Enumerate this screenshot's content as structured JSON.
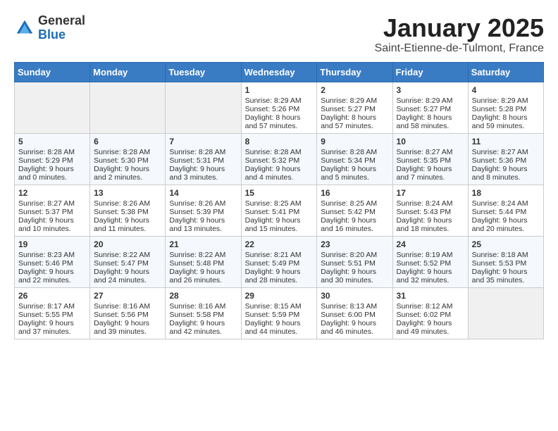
{
  "header": {
    "logo_general": "General",
    "logo_blue": "Blue",
    "month": "January 2025",
    "location": "Saint-Etienne-de-Tulmont, France"
  },
  "days_of_week": [
    "Sunday",
    "Monday",
    "Tuesday",
    "Wednesday",
    "Thursday",
    "Friday",
    "Saturday"
  ],
  "weeks": [
    [
      {
        "day": "",
        "info": ""
      },
      {
        "day": "",
        "info": ""
      },
      {
        "day": "",
        "info": ""
      },
      {
        "day": "1",
        "info": "Sunrise: 8:29 AM\nSunset: 5:26 PM\nDaylight: 8 hours and 57 minutes."
      },
      {
        "day": "2",
        "info": "Sunrise: 8:29 AM\nSunset: 5:27 PM\nDaylight: 8 hours and 57 minutes."
      },
      {
        "day": "3",
        "info": "Sunrise: 8:29 AM\nSunset: 5:27 PM\nDaylight: 8 hours and 58 minutes."
      },
      {
        "day": "4",
        "info": "Sunrise: 8:29 AM\nSunset: 5:28 PM\nDaylight: 8 hours and 59 minutes."
      }
    ],
    [
      {
        "day": "5",
        "info": "Sunrise: 8:28 AM\nSunset: 5:29 PM\nDaylight: 9 hours and 0 minutes."
      },
      {
        "day": "6",
        "info": "Sunrise: 8:28 AM\nSunset: 5:30 PM\nDaylight: 9 hours and 2 minutes."
      },
      {
        "day": "7",
        "info": "Sunrise: 8:28 AM\nSunset: 5:31 PM\nDaylight: 9 hours and 3 minutes."
      },
      {
        "day": "8",
        "info": "Sunrise: 8:28 AM\nSunset: 5:32 PM\nDaylight: 9 hours and 4 minutes."
      },
      {
        "day": "9",
        "info": "Sunrise: 8:28 AM\nSunset: 5:34 PM\nDaylight: 9 hours and 5 minutes."
      },
      {
        "day": "10",
        "info": "Sunrise: 8:27 AM\nSunset: 5:35 PM\nDaylight: 9 hours and 7 minutes."
      },
      {
        "day": "11",
        "info": "Sunrise: 8:27 AM\nSunset: 5:36 PM\nDaylight: 9 hours and 8 minutes."
      }
    ],
    [
      {
        "day": "12",
        "info": "Sunrise: 8:27 AM\nSunset: 5:37 PM\nDaylight: 9 hours and 10 minutes."
      },
      {
        "day": "13",
        "info": "Sunrise: 8:26 AM\nSunset: 5:38 PM\nDaylight: 9 hours and 11 minutes."
      },
      {
        "day": "14",
        "info": "Sunrise: 8:26 AM\nSunset: 5:39 PM\nDaylight: 9 hours and 13 minutes."
      },
      {
        "day": "15",
        "info": "Sunrise: 8:25 AM\nSunset: 5:41 PM\nDaylight: 9 hours and 15 minutes."
      },
      {
        "day": "16",
        "info": "Sunrise: 8:25 AM\nSunset: 5:42 PM\nDaylight: 9 hours and 16 minutes."
      },
      {
        "day": "17",
        "info": "Sunrise: 8:24 AM\nSunset: 5:43 PM\nDaylight: 9 hours and 18 minutes."
      },
      {
        "day": "18",
        "info": "Sunrise: 8:24 AM\nSunset: 5:44 PM\nDaylight: 9 hours and 20 minutes."
      }
    ],
    [
      {
        "day": "19",
        "info": "Sunrise: 8:23 AM\nSunset: 5:46 PM\nDaylight: 9 hours and 22 minutes."
      },
      {
        "day": "20",
        "info": "Sunrise: 8:22 AM\nSunset: 5:47 PM\nDaylight: 9 hours and 24 minutes."
      },
      {
        "day": "21",
        "info": "Sunrise: 8:22 AM\nSunset: 5:48 PM\nDaylight: 9 hours and 26 minutes."
      },
      {
        "day": "22",
        "info": "Sunrise: 8:21 AM\nSunset: 5:49 PM\nDaylight: 9 hours and 28 minutes."
      },
      {
        "day": "23",
        "info": "Sunrise: 8:20 AM\nSunset: 5:51 PM\nDaylight: 9 hours and 30 minutes."
      },
      {
        "day": "24",
        "info": "Sunrise: 8:19 AM\nSunset: 5:52 PM\nDaylight: 9 hours and 32 minutes."
      },
      {
        "day": "25",
        "info": "Sunrise: 8:18 AM\nSunset: 5:53 PM\nDaylight: 9 hours and 35 minutes."
      }
    ],
    [
      {
        "day": "26",
        "info": "Sunrise: 8:17 AM\nSunset: 5:55 PM\nDaylight: 9 hours and 37 minutes."
      },
      {
        "day": "27",
        "info": "Sunrise: 8:16 AM\nSunset: 5:56 PM\nDaylight: 9 hours and 39 minutes."
      },
      {
        "day": "28",
        "info": "Sunrise: 8:16 AM\nSunset: 5:58 PM\nDaylight: 9 hours and 42 minutes."
      },
      {
        "day": "29",
        "info": "Sunrise: 8:15 AM\nSunset: 5:59 PM\nDaylight: 9 hours and 44 minutes."
      },
      {
        "day": "30",
        "info": "Sunrise: 8:13 AM\nSunset: 6:00 PM\nDaylight: 9 hours and 46 minutes."
      },
      {
        "day": "31",
        "info": "Sunrise: 8:12 AM\nSunset: 6:02 PM\nDaylight: 9 hours and 49 minutes."
      },
      {
        "day": "",
        "info": ""
      }
    ]
  ]
}
